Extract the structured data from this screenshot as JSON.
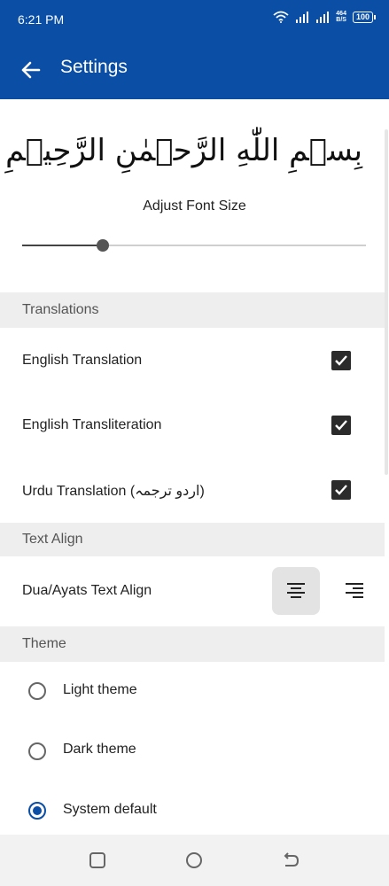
{
  "status_bar": {
    "time": "6:21 PM",
    "speed": "464",
    "speed_unit": "B/S",
    "battery": "100"
  },
  "app_bar": {
    "title": "Settings",
    "back_icon": "arrow-left-icon"
  },
  "font_section": {
    "preview_text": "بِسۡمِ اللّٰهِ الرَّحۡمٰنِ الرَّحِيۡمِ",
    "label": "Adjust Font Size",
    "slider_value": 0.235
  },
  "translations": {
    "header": "Translations",
    "items": [
      {
        "label": "English Translation",
        "checked": true
      },
      {
        "label": "English Transliteration",
        "checked": true
      },
      {
        "label": "Urdu Translation (اردو ترجمہ)",
        "checked": true
      }
    ]
  },
  "text_align": {
    "header": "Text Align",
    "label": "Dua/Ayats Text Align",
    "selected": "center",
    "options": [
      "center",
      "right"
    ]
  },
  "theme": {
    "header": "Theme",
    "options": [
      {
        "label": "Light theme",
        "selected": false
      },
      {
        "label": "Dark theme",
        "selected": false
      },
      {
        "label": "System default",
        "selected": true
      }
    ]
  },
  "colors": {
    "primary": "#0a4ea6",
    "section_bg": "#eeeeee"
  }
}
